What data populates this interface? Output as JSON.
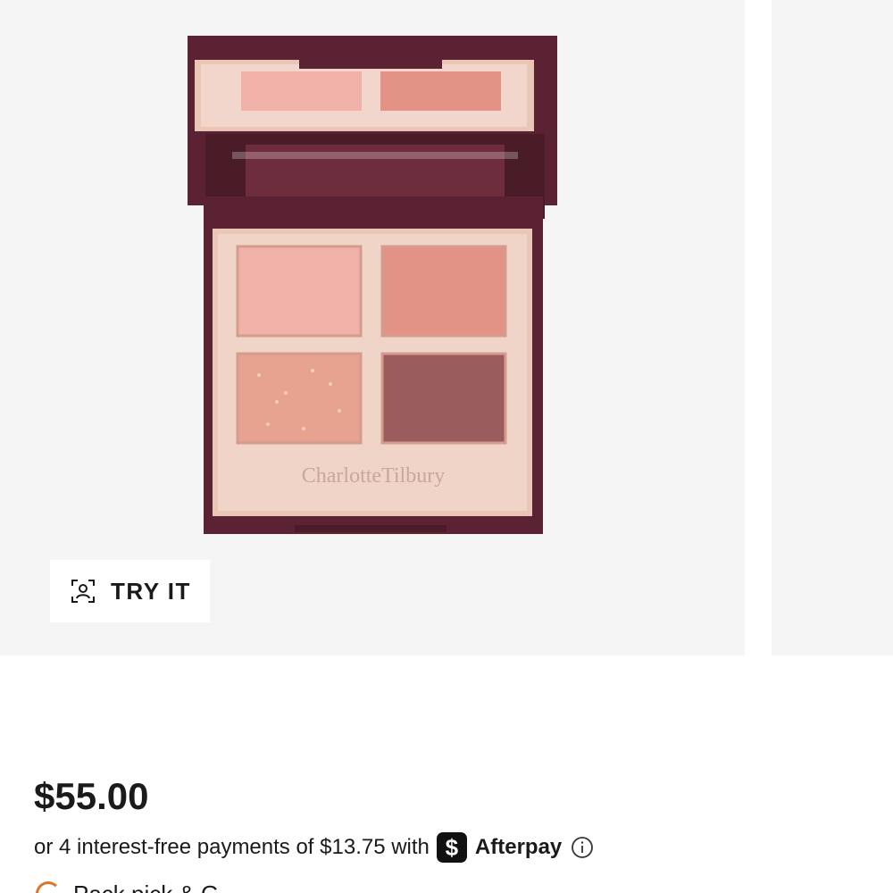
{
  "gallery": {
    "brand_mark": "CharlotteTilbury",
    "palette_colors": {
      "case": "#5a2232",
      "gold": "#e9c6b6",
      "shade_1": "#f0b2a8",
      "shade_2": "#e29386",
      "shade_3": "#e7a38f",
      "shade_4": "#9b5c5e"
    }
  },
  "try_it": {
    "icon": "face-scan-icon",
    "label": "TRY IT"
  },
  "pricing": {
    "price": "$55.00",
    "installment_text": "or 4 interest-free payments of $13.75 with",
    "afterpay_badge": "$",
    "afterpay_label": "Afterpay",
    "info_icon": "info-icon"
  },
  "cutoff_row": {
    "icon": "pickup-icon",
    "text": "Pack pick & G"
  }
}
